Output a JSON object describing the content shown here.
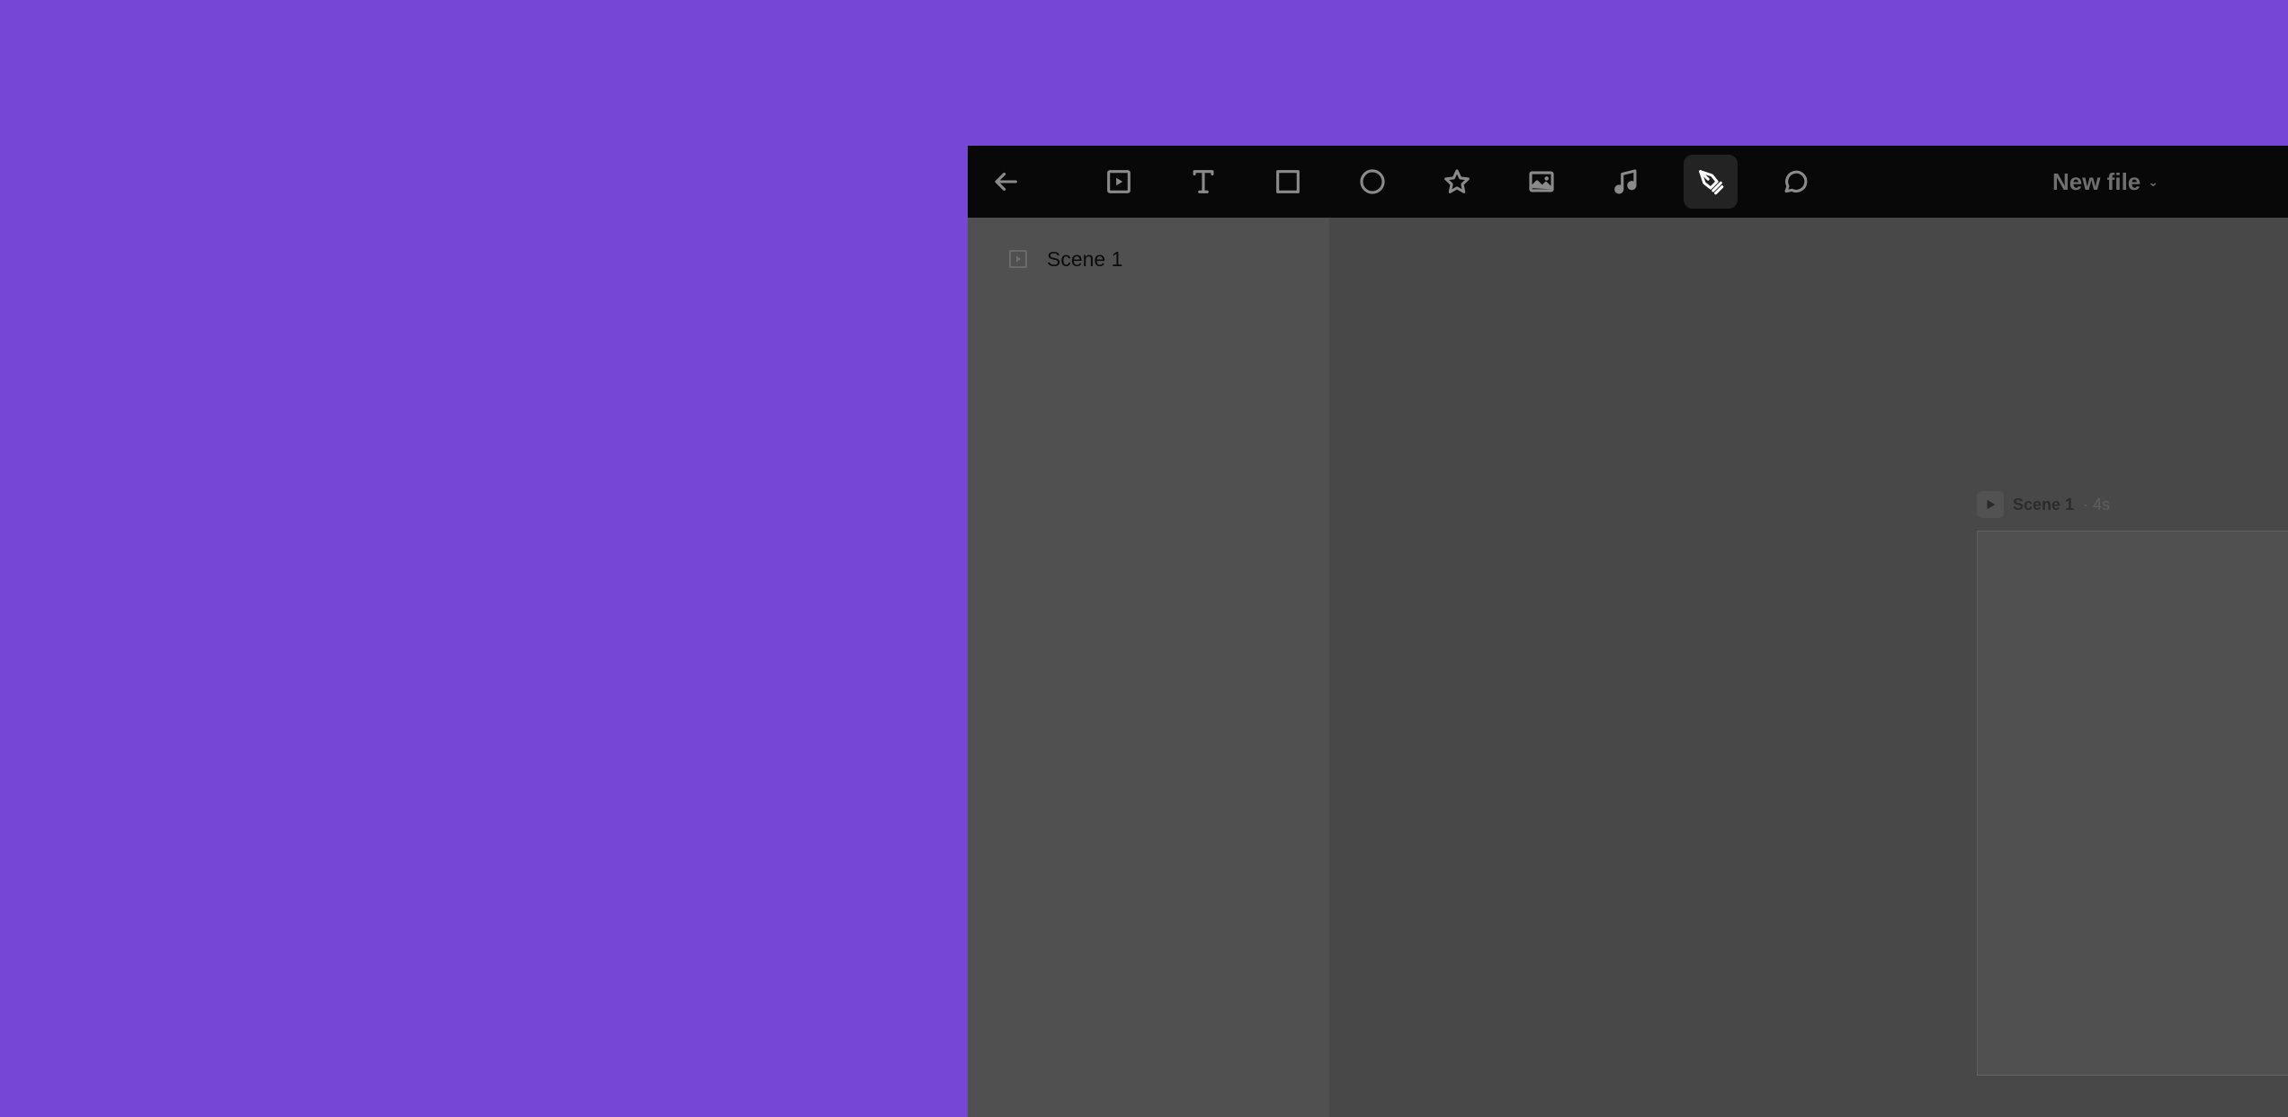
{
  "toolbar": {
    "tools": [
      {
        "id": "back",
        "icon": "arrow-left-icon"
      },
      {
        "id": "scene",
        "icon": "scene-play-icon"
      },
      {
        "id": "text",
        "icon": "text-icon"
      },
      {
        "id": "rectangle",
        "icon": "rectangle-icon"
      },
      {
        "id": "ellipse",
        "icon": "circle-icon"
      },
      {
        "id": "star",
        "icon": "star-icon"
      },
      {
        "id": "image",
        "icon": "image-icon"
      },
      {
        "id": "audio",
        "icon": "music-note-icon"
      },
      {
        "id": "pen",
        "icon": "pen-tool-icon",
        "active": true
      },
      {
        "id": "comment",
        "icon": "comment-bubble-icon"
      }
    ],
    "file_name": "New file",
    "file_menu_icon": "chevron-down-icon"
  },
  "sidebar": {
    "scenes": [
      {
        "label": "Scene 1",
        "icon": "scene-play-icon"
      }
    ]
  },
  "canvas": {
    "scene_title": "Scene 1",
    "scene_duration": "· 4s",
    "play_icon": "play-icon"
  },
  "colors": {
    "page_background": "#7647d7",
    "toolbar_background": "#080808",
    "sidebar_background": "#505050",
    "canvas_background": "#484848",
    "active_tool_background": "#232323"
  }
}
